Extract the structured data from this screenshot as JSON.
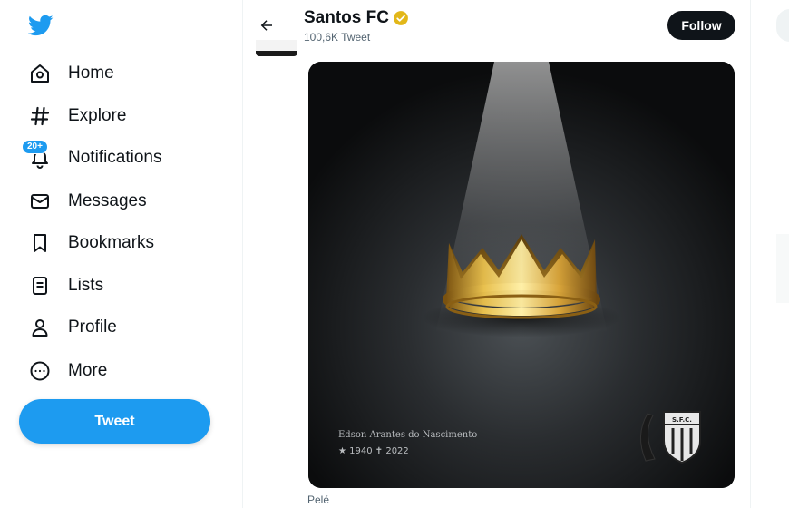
{
  "sidebar": {
    "items": [
      {
        "label": "Home",
        "icon": "home-icon"
      },
      {
        "label": "Explore",
        "icon": "hashtag-icon"
      },
      {
        "label": "Notifications",
        "icon": "bell-icon",
        "badge": "20+"
      },
      {
        "label": "Messages",
        "icon": "envelope-icon"
      },
      {
        "label": "Bookmarks",
        "icon": "bookmark-icon"
      },
      {
        "label": "Lists",
        "icon": "list-icon"
      },
      {
        "label": "Profile",
        "icon": "person-icon"
      },
      {
        "label": "More",
        "icon": "more-circle-icon"
      }
    ],
    "tweet_label": "Tweet"
  },
  "header": {
    "name": "Santos FC",
    "tweet_count": "100,6K Tweet",
    "follow_label": "Follow"
  },
  "media": {
    "name_text": "Edson Arantes do Nascimento",
    "dates_text": "★ 1940  ✝ 2022",
    "crest_text": "S.F.C."
  },
  "tweet": {
    "caption": "Pelé"
  },
  "colors": {
    "accent": "#1d9bf0",
    "text": "#0f1419",
    "muted": "#536471",
    "gold": "#d4a533",
    "verified": "#e2b719"
  }
}
